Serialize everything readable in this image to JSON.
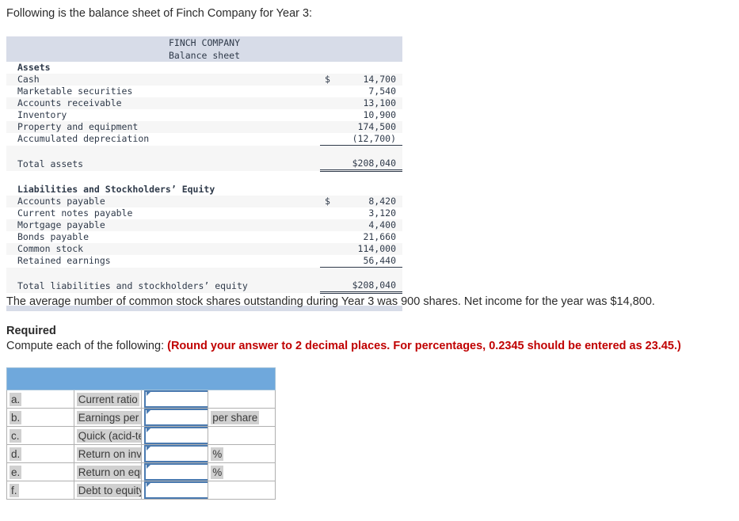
{
  "intro": "Following is the balance sheet of Finch Company for Year 3:",
  "balance_sheet": {
    "company": "FINCH COMPANY",
    "statement": "Balance sheet",
    "sections": [
      {
        "heading": "Assets",
        "rows": [
          {
            "label": "Cash",
            "symbol": "$",
            "amount": "14,700"
          },
          {
            "label": "Marketable securities",
            "symbol": "",
            "amount": "7,540"
          },
          {
            "label": "Accounts receivable",
            "symbol": "",
            "amount": "13,100"
          },
          {
            "label": "Inventory",
            "symbol": "",
            "amount": "10,900"
          },
          {
            "label": "Property and equipment",
            "symbol": "",
            "amount": "174,500"
          },
          {
            "label": "Accumulated depreciation",
            "symbol": "",
            "amount": "(12,700)"
          }
        ],
        "total": {
          "label": "Total assets",
          "amount": "$208,040"
        }
      },
      {
        "heading": "Liabilities and Stockholders’ Equity",
        "rows": [
          {
            "label": "Accounts payable",
            "symbol": "$",
            "amount": "8,420"
          },
          {
            "label": "Current notes payable",
            "symbol": "",
            "amount": "3,120"
          },
          {
            "label": "Mortgage payable",
            "symbol": "",
            "amount": "4,400"
          },
          {
            "label": "Bonds payable",
            "symbol": "",
            "amount": "21,660"
          },
          {
            "label": "Common stock",
            "symbol": "",
            "amount": "114,000"
          },
          {
            "label": "Retained earnings",
            "symbol": "",
            "amount": "56,440"
          }
        ],
        "total": {
          "label": "Total liabilities and stockholders’ equity",
          "amount": "$208,040"
        }
      }
    ]
  },
  "average_shares_note": "The average number of common stock shares outstanding during Year 3 was 900 shares. Net income for the year was $14,800.",
  "required": {
    "heading": "Required",
    "lead": "Compute each of the following:",
    "note": "(Round your answer to 2 decimal places. For percentages, 0.2345 should be entered as 23.45.)"
  },
  "answer_table": {
    "header_color": "#6fa8dc",
    "rows": [
      {
        "letter": "a.",
        "name": "Current ratio",
        "value": "",
        "unit": ""
      },
      {
        "letter": "b.",
        "name": "Earnings per share",
        "value": "",
        "unit": "per share"
      },
      {
        "letter": "c.",
        "name": "Quick (acid-test) ratio",
        "value": "",
        "unit": ""
      },
      {
        "letter": "d.",
        "name": "Return on investment",
        "value": "",
        "unit": "%"
      },
      {
        "letter": "e.",
        "name": "Return on equity",
        "value": "",
        "unit": "%"
      },
      {
        "letter": "f.",
        "name": "Debt to equity ratio",
        "value": "",
        "unit": ""
      }
    ]
  }
}
